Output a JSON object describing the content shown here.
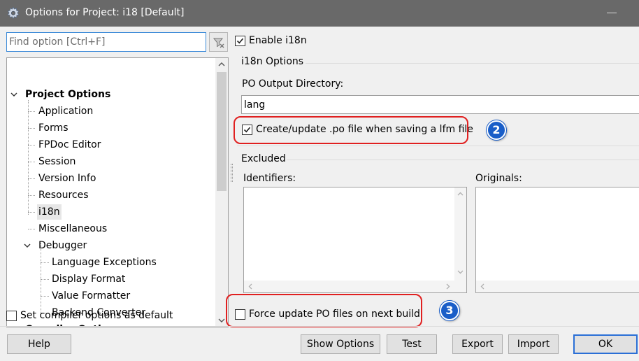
{
  "window": {
    "title": "Options for Project: i18 [Default]"
  },
  "sidebar": {
    "search_placeholder": "Find option [Ctrl+F]",
    "tree": {
      "project_options": "Project Options",
      "application": "Application",
      "forms": "Forms",
      "fpdoc_editor": "FPDoc Editor",
      "session": "Session",
      "version_info": "Version Info",
      "resources": "Resources",
      "i18n": "i18n",
      "miscellaneous": "Miscellaneous",
      "debugger": "Debugger",
      "language_exceptions": "Language Exceptions",
      "display_format": "Display Format",
      "value_formatter": "Value Formatter",
      "backend_converter": "Backend Converter",
      "compiler_options": "Compiler Options"
    },
    "set_default_label": "Set compiler options as default",
    "set_default_checked": false
  },
  "main": {
    "enable_label": "Enable i18n",
    "enable_checked": true,
    "options_group": "i18n Options",
    "po_dir_label": "PO Output Directory:",
    "po_dir_value": "lang",
    "create_update_label": "Create/update .po file when saving a lfm file",
    "create_update_checked": true,
    "excluded_group": "Excluded",
    "identifiers_label": "Identifiers:",
    "originals_label": "Originals:",
    "force_update_label": "Force update PO files on next build",
    "force_update_checked": false
  },
  "annotations": {
    "badge_2": "2",
    "badge_3": "3",
    "callout_color": "#e02020",
    "badge_color": "#1a5ec8"
  },
  "buttons": {
    "help": "Help",
    "show_options": "Show Options",
    "test": "Test",
    "export": "Export",
    "import": "Import",
    "ok": "OK"
  },
  "icons": {
    "app": "gear-icon",
    "filter": "filter-clear-icon",
    "tree_expanded": "chevron-down-icon",
    "scroll_up": "chevron-up-icon",
    "scroll_down": "chevron-down-icon"
  }
}
